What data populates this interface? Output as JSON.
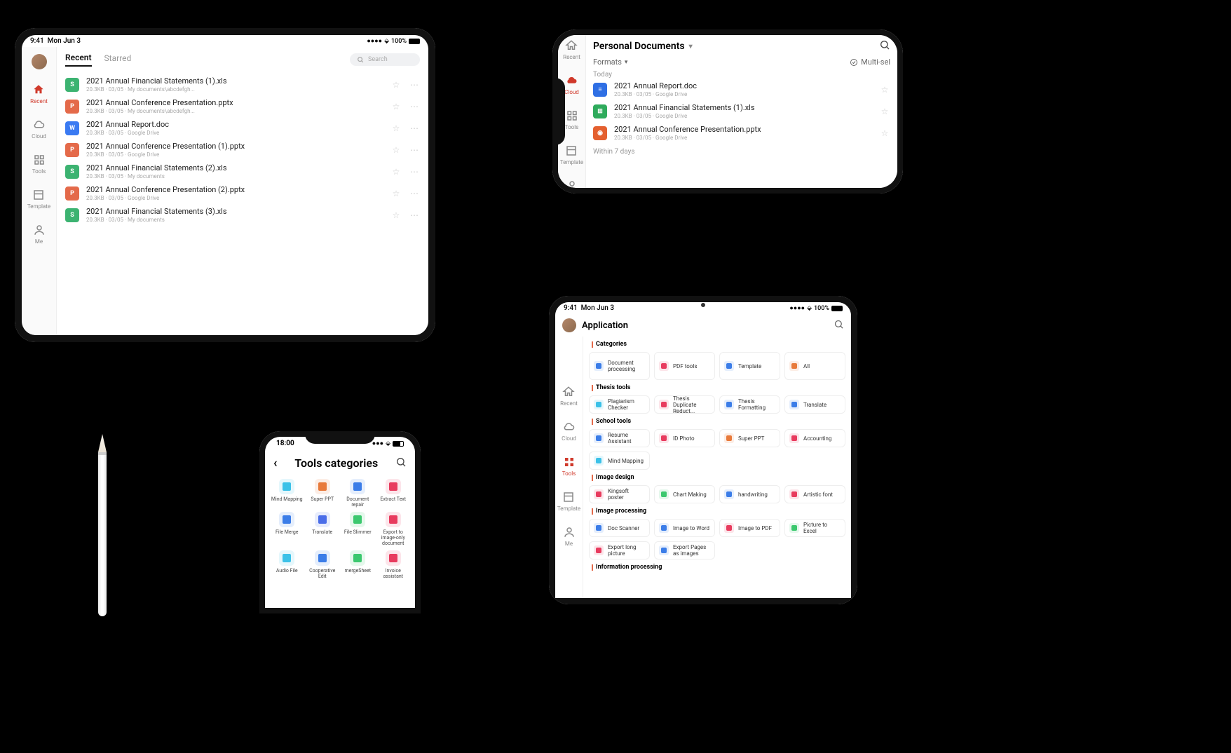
{
  "statusbar": {
    "time": "9:41",
    "date": "Mon Jun 3",
    "battery": "100%"
  },
  "statusbar_phone": {
    "time": "18:00"
  },
  "sidebar": {
    "items": [
      {
        "key": "recent",
        "label": "Recent"
      },
      {
        "key": "cloud",
        "label": "Cloud"
      },
      {
        "key": "tools",
        "label": "Tools"
      },
      {
        "key": "template",
        "label": "Template"
      },
      {
        "key": "me",
        "label": "Me"
      }
    ]
  },
  "recent_tabs": {
    "recent": "Recent",
    "starred": "Starred",
    "search_placeholder": "Search"
  },
  "recent_files": [
    {
      "type": "xls",
      "name": "2021 Annual Financial Statements (1).xls",
      "meta": "20.3KB · 03/05 · My documents\\abcdefgh..."
    },
    {
      "type": "ppt",
      "name": "2021 Annual Conference Presentation.pptx",
      "meta": "20.3KB · 03/05 · My documents\\abcdefgh..."
    },
    {
      "type": "doc",
      "name": "2021 Annual Report.doc",
      "meta": "20.3KB · 03/05 · Google Drive"
    },
    {
      "type": "ppt",
      "name": "2021 Annual Conference Presentation (1).pptx",
      "meta": "20.3KB · 03/05 · Google Drive"
    },
    {
      "type": "xls",
      "name": "2021 Annual Financial Statements (2).xls",
      "meta": "20.3KB · 03/05 · My documents"
    },
    {
      "type": "ppt",
      "name": "2021 Annual Conference Presentation (2).pptx",
      "meta": "20.3KB · 03/05 · Google Drive"
    },
    {
      "type": "xls",
      "name": "2021 Annual Financial Statements (3).xls",
      "meta": "20.3KB · 03/05 · My documents"
    }
  ],
  "personal_docs": {
    "title": "Personal Documents",
    "formats": "Formats",
    "multi": "Multi-sel",
    "today": "Today",
    "within7": "Within 7 days",
    "files": [
      {
        "type": "gdoc",
        "name": "2021 Annual Report.doc",
        "meta": "20.3KB · 03/05 · Google Drive"
      },
      {
        "type": "gsheet",
        "name": "2021 Annual Financial Statements (1).xls",
        "meta": "20.3KB · 03/05 · Google Drive"
      },
      {
        "type": "gslide",
        "name": "2021 Annual Conference Presentation.pptx",
        "meta": "20.3KB · 03/05 · Google Drive"
      }
    ]
  },
  "tools_phone": {
    "title": "Tools categories",
    "items": [
      {
        "label": "Mind Mapping",
        "c": "#3bc1e8"
      },
      {
        "label": "Super PPT",
        "c": "#e87a3b"
      },
      {
        "label": "Document repair",
        "c": "#3b7de8"
      },
      {
        "label": "Extract Text",
        "c": "#e83b5e"
      },
      {
        "label": "File Merge",
        "c": "#3b7de8"
      },
      {
        "label": "Translate",
        "c": "#4a6de8"
      },
      {
        "label": "File Slimmer",
        "c": "#3bc86e"
      },
      {
        "label": "Export to image-only document",
        "c": "#e83b5e"
      },
      {
        "label": "Audio File",
        "c": "#3bc1e8"
      },
      {
        "label": "Cooperative Edit",
        "c": "#3b7de8"
      },
      {
        "label": "mergeSheet",
        "c": "#3bc86e"
      },
      {
        "label": "Invoice assistant",
        "c": "#e83b5e"
      }
    ]
  },
  "application": {
    "title": "Application",
    "sections": {
      "categories": "Categories",
      "thesis": "Thesis tools",
      "school": "School tools",
      "image_design": "Image design",
      "image_proc": "Image processing",
      "info_proc": "Information processing"
    },
    "cat_cards": [
      {
        "label": "Document processing",
        "c": "#3b7de8"
      },
      {
        "label": "PDF tools",
        "c": "#e83b5e"
      },
      {
        "label": "Template",
        "c": "#3b7de8"
      },
      {
        "label": "All",
        "c": "#e87a3b"
      }
    ],
    "thesis_cards": [
      {
        "label": "Plagiarism Checker",
        "c": "#3bc1e8"
      },
      {
        "label": "Thesis Duplicate Reduct...",
        "c": "#e83b5e"
      },
      {
        "label": "Thesis Formatting",
        "c": "#3b7de8"
      },
      {
        "label": "Translate",
        "c": "#3b7de8"
      }
    ],
    "school_cards": [
      {
        "label": "Resume Assistant",
        "c": "#3b7de8"
      },
      {
        "label": "ID Photo",
        "c": "#e83b5e"
      },
      {
        "label": "Super PPT",
        "c": "#e87a3b"
      },
      {
        "label": "Accounting",
        "c": "#e83b5e"
      },
      {
        "label": "Mind Mapping",
        "c": "#3bc1e8"
      }
    ],
    "imgd_cards": [
      {
        "label": "Kingsoft poster",
        "c": "#e83b5e"
      },
      {
        "label": "Chart Making",
        "c": "#3bc86e"
      },
      {
        "label": "handwriting",
        "c": "#3b7de8"
      },
      {
        "label": "Artistic font",
        "c": "#e83b5e"
      }
    ],
    "imgp_cards": [
      {
        "label": "Doc Scanner",
        "c": "#3b7de8"
      },
      {
        "label": "Image to Word",
        "c": "#3b7de8"
      },
      {
        "label": "Image to PDF",
        "c": "#e83b5e"
      },
      {
        "label": "Picture to Excel",
        "c": "#3bc86e"
      },
      {
        "label": "Export long picture",
        "c": "#e83b5e"
      },
      {
        "label": "Export Pages as images",
        "c": "#3b7de8"
      }
    ]
  }
}
